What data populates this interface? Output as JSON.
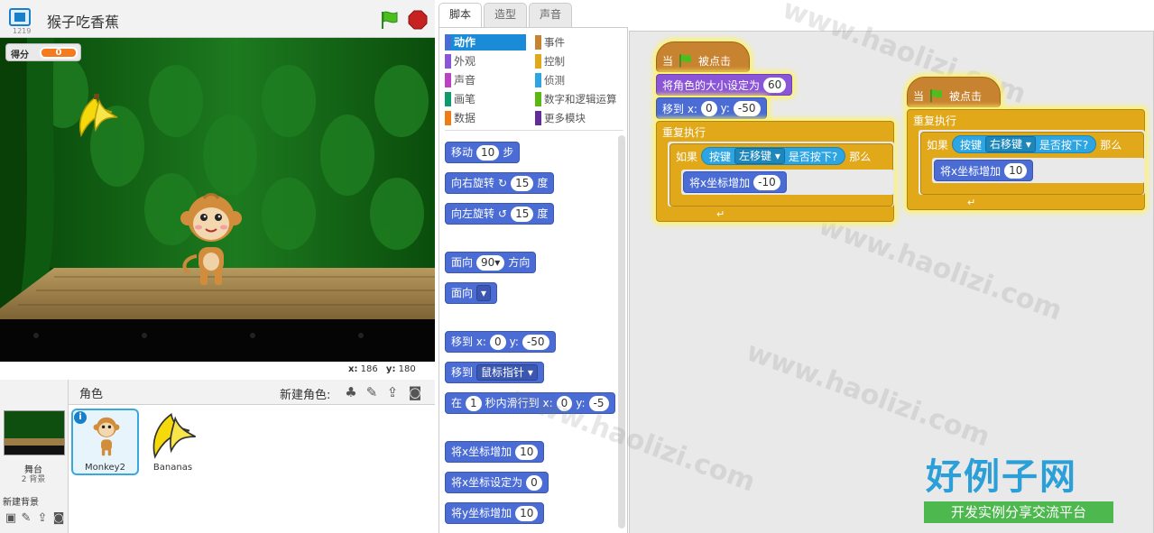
{
  "stage_header": {
    "title": "猴子吃香蕉",
    "version": "1219"
  },
  "stage": {
    "score_label": "得分",
    "score_value": "0",
    "coords": {
      "x_label": "x:",
      "x": "186",
      "y_label": "y:",
      "y": "180"
    }
  },
  "sprite_pane": {
    "title": "角色",
    "new_sprite_label": "新建角色:",
    "stage_label": "舞台",
    "backdrop_count": "2 背景",
    "new_backdrop_label": "新建背景",
    "sprites": [
      {
        "name": "Monkey2",
        "selected": true
      },
      {
        "name": "Bananas",
        "selected": false
      }
    ]
  },
  "tabs": [
    "脚本",
    "造型",
    "声音"
  ],
  "categories": [
    {
      "label": "动作",
      "color": "#4a6cd4",
      "selected": true
    },
    {
      "label": "外观",
      "color": "#8a55d7",
      "selected": false
    },
    {
      "label": "声音",
      "color": "#bb42c3",
      "selected": false
    },
    {
      "label": "画笔",
      "color": "#0e9a6c",
      "selected": false
    },
    {
      "label": "数据",
      "color": "#ee7d16",
      "selected": false
    },
    {
      "label": "事件",
      "color": "#c88330",
      "selected": false
    },
    {
      "label": "控制",
      "color": "#e1a91a",
      "selected": false
    },
    {
      "label": "侦测",
      "color": "#2ca5e2",
      "selected": false
    },
    {
      "label": "数字和逻辑运算",
      "color": "#5cb712",
      "selected": false
    },
    {
      "label": "更多模块",
      "color": "#632d99",
      "selected": false
    }
  ],
  "palette_blocks": {
    "move": {
      "a": "移动",
      "v": "10",
      "b": "步"
    },
    "turn_right": {
      "a": "向右旋转",
      "v": "15",
      "b": "度"
    },
    "turn_left": {
      "a": "向左旋转",
      "v": "15",
      "b": "度"
    },
    "point_dir": {
      "a": "面向",
      "v": "90▾",
      "b": "方向"
    },
    "point_towards": {
      "a": "面向",
      "v": "▾"
    },
    "goto_xy": {
      "a": "移到 x:",
      "x": "0",
      "b": "y:",
      "y": "-50"
    },
    "goto_target": {
      "a": "移到",
      "v": "鼠标指针"
    },
    "glide": {
      "a": "在",
      "v": "1",
      "b": "秒内滑行到 x:",
      "x": "0",
      "c": "y:",
      "y": "-5"
    },
    "change_x": {
      "a": "将x坐标增加",
      "v": "10"
    },
    "set_x": {
      "a": "将x坐标设定为",
      "v": "0"
    },
    "change_y": {
      "a": "将y坐标增加",
      "v": "10"
    }
  },
  "script1": {
    "hat_a": "当",
    "hat_b": "被点击",
    "set_size": "将角色的大小设定为",
    "size": "60",
    "goto_a": "移到 x:",
    "x": "0",
    "goto_b": "y:",
    "y": "-50",
    "forever": "重复执行",
    "if_a": "如果",
    "key_a": "按键",
    "key": "左移键",
    "key_b": "是否按下?",
    "then": "那么",
    "change_x": "将x坐标增加",
    "dx": "-10"
  },
  "script2": {
    "hat_a": "当",
    "hat_b": "被点击",
    "forever": "重复执行",
    "if_a": "如果",
    "key_a": "按键",
    "key": "右移键",
    "key_b": "是否按下?",
    "then": "那么",
    "change_x": "将x坐标增加",
    "dx": "10"
  },
  "watermark": "www.haolizi.com",
  "logo": {
    "main": "好例子网",
    "sub": "开发实例分享交流平台"
  }
}
